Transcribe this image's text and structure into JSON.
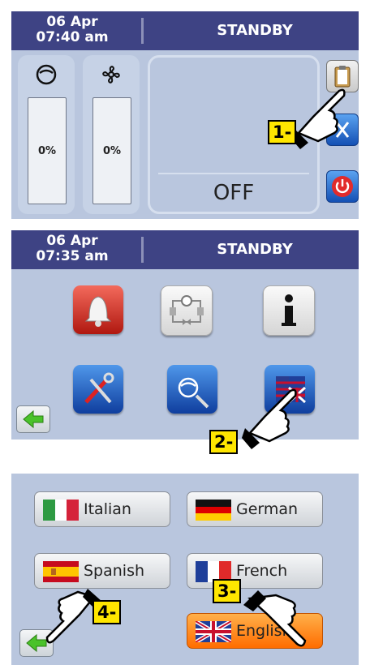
{
  "screen1": {
    "date": "06 Apr",
    "time": "07:40 am",
    "status": "STANDBY",
    "compressor_percent": "0%",
    "fan_percent": "0%",
    "unit_state": "OFF",
    "icons": [
      "compressor-icon",
      "fan-icon",
      "clipboard-icon",
      "valve-icon",
      "power-icon"
    ]
  },
  "screen2": {
    "date": "06 Apr",
    "time": "07:35 am",
    "status": "STANDBY",
    "menu_icons": [
      "alarm-bell-icon",
      "refrigerant-circuit-icon",
      "info-icon",
      "tools-icon",
      "compressor-wrench-icon",
      "language-flag-icon"
    ]
  },
  "screen3": {
    "languages": [
      "Italian",
      "German",
      "Spanish",
      "French",
      "English"
    ],
    "selected": "English"
  },
  "steps": [
    "1-",
    "2-",
    "3-",
    "4-"
  ],
  "colors": {
    "header": "#3e4384",
    "panel": "#b9c6de",
    "highlight": "#ff8a1a",
    "tag": "#ffe600"
  }
}
